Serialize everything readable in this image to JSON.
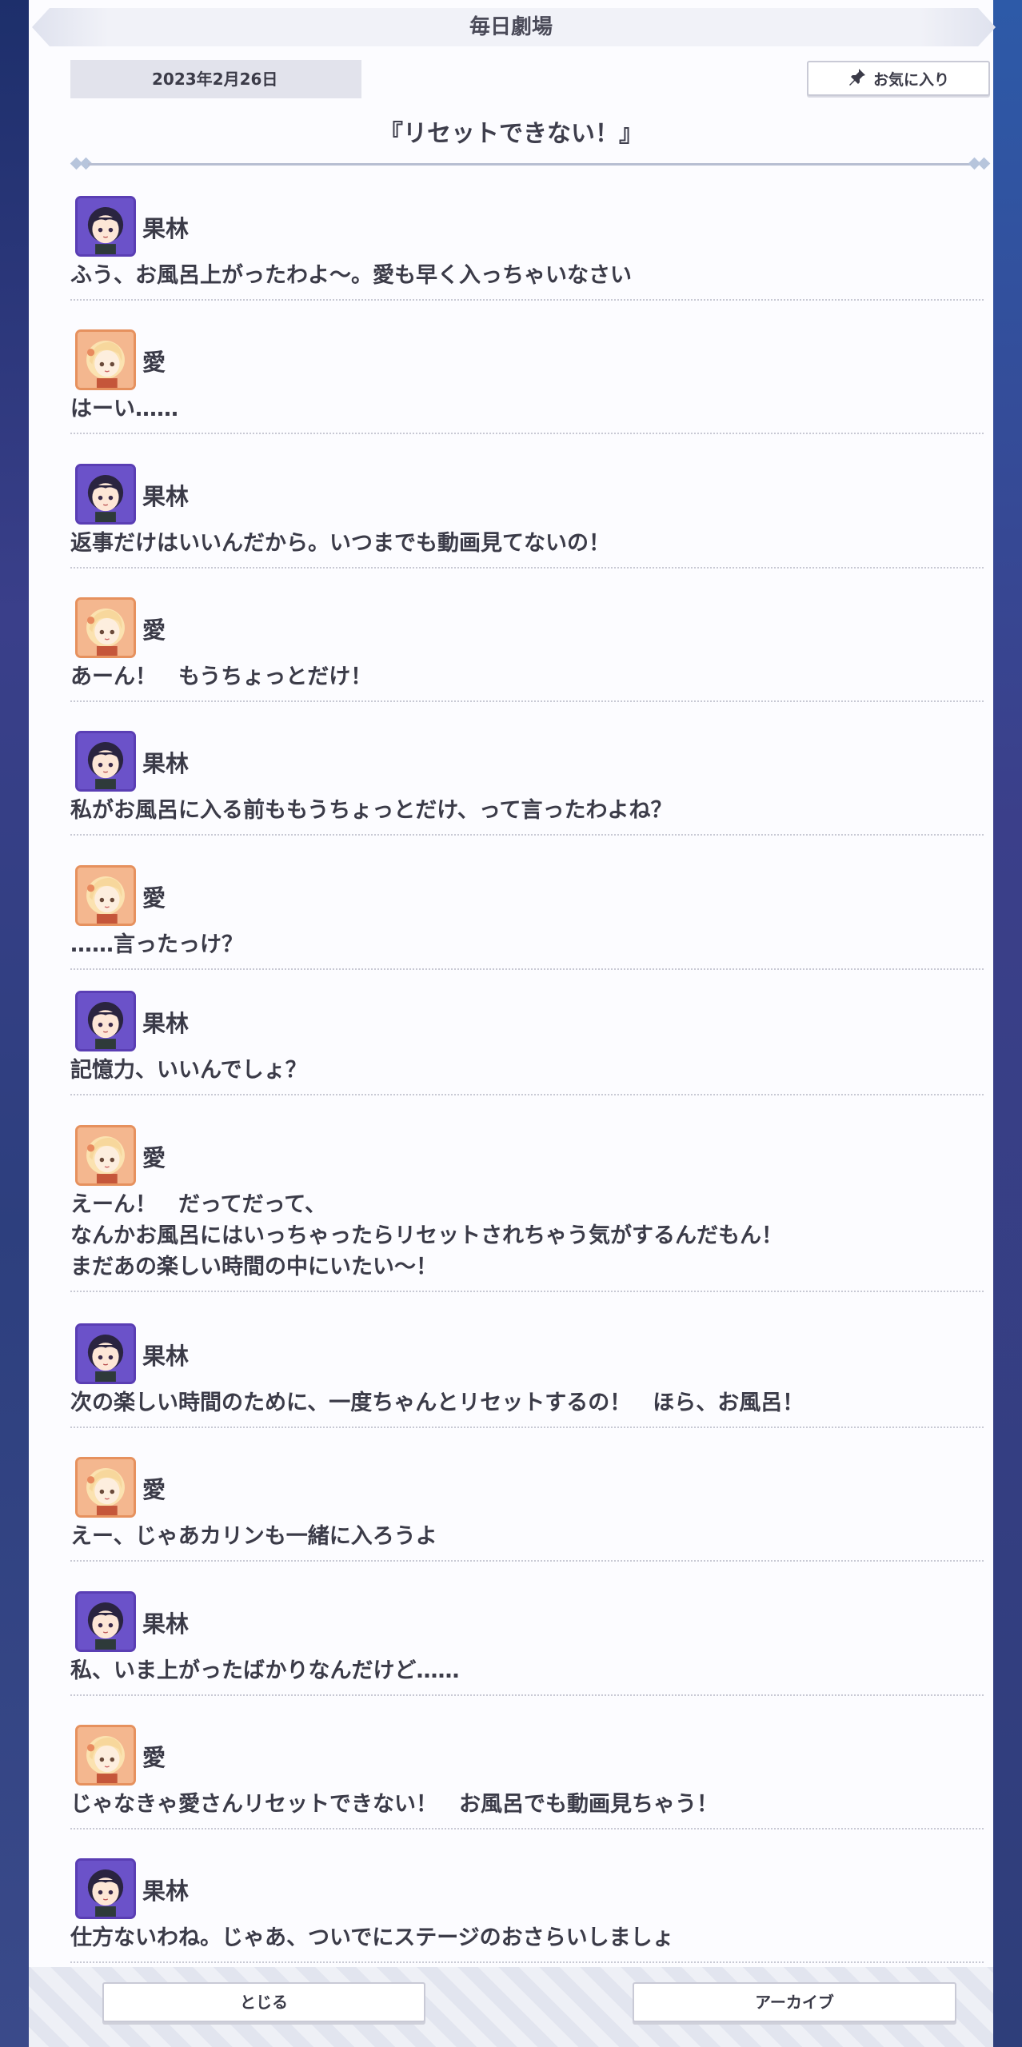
{
  "header": {
    "title": "毎日劇場"
  },
  "date": "2023年2月26日",
  "favorite_label": "お気に入り",
  "story_title": "『リセットできない！』",
  "dialogue": [
    {
      "speaker": "果林",
      "character": "karin",
      "lines": [
        "ふう、お風呂上がったわよ〜。愛も早く入っちゃいなさい"
      ]
    },
    {
      "speaker": "愛",
      "character": "ai",
      "lines": [
        "はーい……"
      ]
    },
    {
      "speaker": "果林",
      "character": "karin",
      "lines": [
        "返事だけはいいんだから。いつまでも動画見てないの！"
      ]
    },
    {
      "speaker": "愛",
      "character": "ai",
      "lines": [
        "あーん！　もうちょっとだけ！"
      ]
    },
    {
      "speaker": "果林",
      "character": "karin",
      "lines": [
        "私がお風呂に入る前ももうちょっとだけ、って言ったわよね？"
      ]
    },
    {
      "speaker": "愛",
      "character": "ai",
      "lines": [
        "……言ったっけ？"
      ]
    },
    {
      "speaker": "果林",
      "character": "karin",
      "lines": [
        "記憶力、いいんでしょ？"
      ]
    },
    {
      "speaker": "愛",
      "character": "ai",
      "lines": [
        "えーん！　だってだって、",
        "なんかお風呂にはいっちゃったらリセットされちゃう気がするんだもん！",
        "まだあの楽しい時間の中にいたい〜！"
      ]
    },
    {
      "speaker": "果林",
      "character": "karin",
      "lines": [
        "次の楽しい時間のために、一度ちゃんとリセットするの！　ほら、お風呂！"
      ]
    },
    {
      "speaker": "愛",
      "character": "ai",
      "lines": [
        "えー、じゃあカリンも一緒に入ろうよ"
      ]
    },
    {
      "speaker": "果林",
      "character": "karin",
      "lines": [
        "私、いま上がったばかりなんだけど……"
      ]
    },
    {
      "speaker": "愛",
      "character": "ai",
      "lines": [
        "じゃなきゃ愛さんリセットできない！　お風呂でも動画見ちゃう！"
      ]
    },
    {
      "speaker": "果林",
      "character": "karin",
      "lines": [
        "仕方ないわね。じゃあ、ついでにステージのおさらいしましょ"
      ]
    }
  ],
  "footer": {
    "close_label": "とじる",
    "archive_label": "アーカイブ"
  }
}
